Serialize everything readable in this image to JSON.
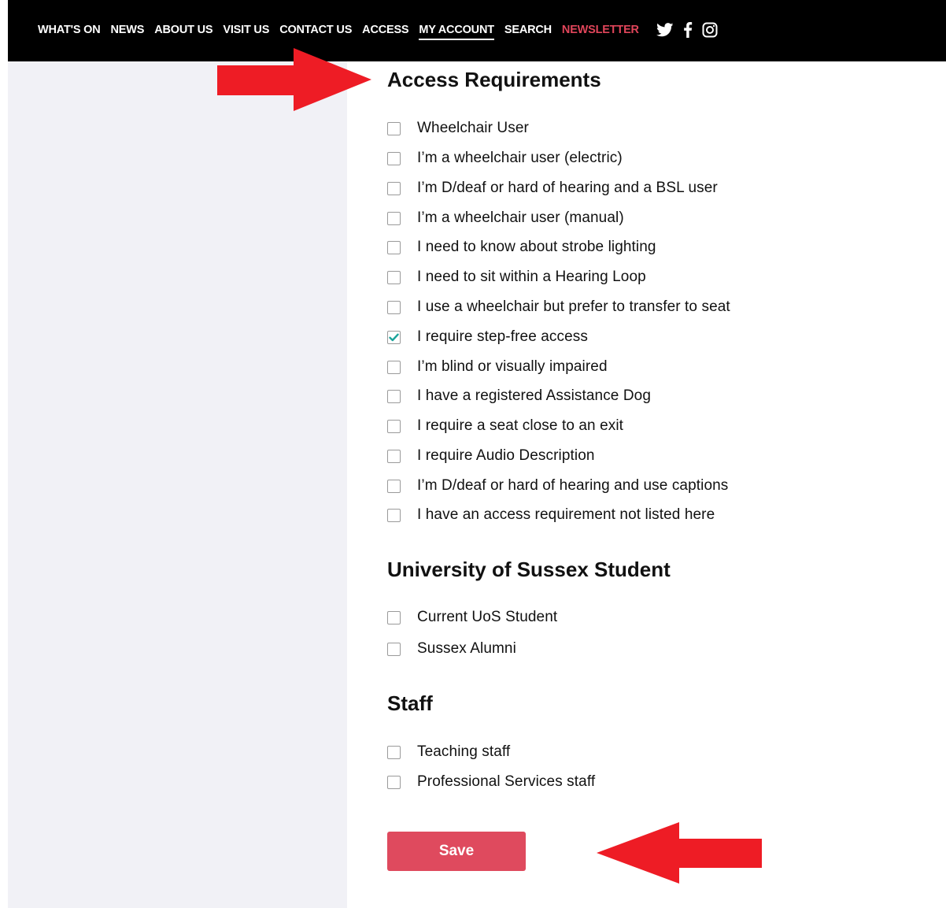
{
  "nav": {
    "items": [
      {
        "label": "WHAT'S ON"
      },
      {
        "label": "NEWS"
      },
      {
        "label": "ABOUT US"
      },
      {
        "label": "VISIT US"
      },
      {
        "label": "CONTACT US"
      },
      {
        "label": "ACCESS"
      },
      {
        "label": "MY ACCOUNT",
        "active": true
      },
      {
        "label": "SEARCH"
      },
      {
        "label": "NEWSLETTER",
        "color": "#e0455a"
      }
    ],
    "social_icons": [
      "twitter-icon",
      "facebook-icon",
      "instagram-icon"
    ]
  },
  "sections": {
    "access": {
      "title": "Access Requirements",
      "options": [
        {
          "label": "Wheelchair User",
          "checked": false
        },
        {
          "label": "I’m a wheelchair user (electric)",
          "checked": false
        },
        {
          "label": "I’m D/deaf or hard of hearing and a BSL user",
          "checked": false
        },
        {
          "label": "I’m a wheelchair user (manual)",
          "checked": false
        },
        {
          "label": "I need to know about strobe lighting",
          "checked": false
        },
        {
          "label": "I need to sit within a Hearing Loop",
          "checked": false
        },
        {
          "label": "I use a wheelchair but prefer to transfer to seat",
          "checked": false
        },
        {
          "label": "I require step-free access",
          "checked": true
        },
        {
          "label": "I’m blind or visually impaired",
          "checked": false
        },
        {
          "label": "I have a registered Assistance Dog",
          "checked": false
        },
        {
          "label": "I require a seat close to an exit",
          "checked": false
        },
        {
          "label": "I require Audio Description",
          "checked": false
        },
        {
          "label": "I’m D/deaf or hard of hearing and use captions",
          "checked": false
        },
        {
          "label": "I have an access requirement not listed here",
          "checked": false
        }
      ]
    },
    "student": {
      "title": "University of Sussex Student",
      "options": [
        {
          "label": "Current UoS Student",
          "checked": false
        },
        {
          "label": "Sussex Alumni",
          "checked": false
        }
      ]
    },
    "staff": {
      "title": "Staff",
      "options": [
        {
          "label": "Teaching staff",
          "checked": false
        },
        {
          "label": "Professional Services staff",
          "checked": false
        }
      ]
    }
  },
  "save_label": "Save",
  "colors": {
    "nav_bg": "#000000",
    "sidebar_bg": "#f1f1f6",
    "save_bg": "#df4a5e",
    "check": "#1aa39a",
    "arrow": "#ee1c25"
  }
}
